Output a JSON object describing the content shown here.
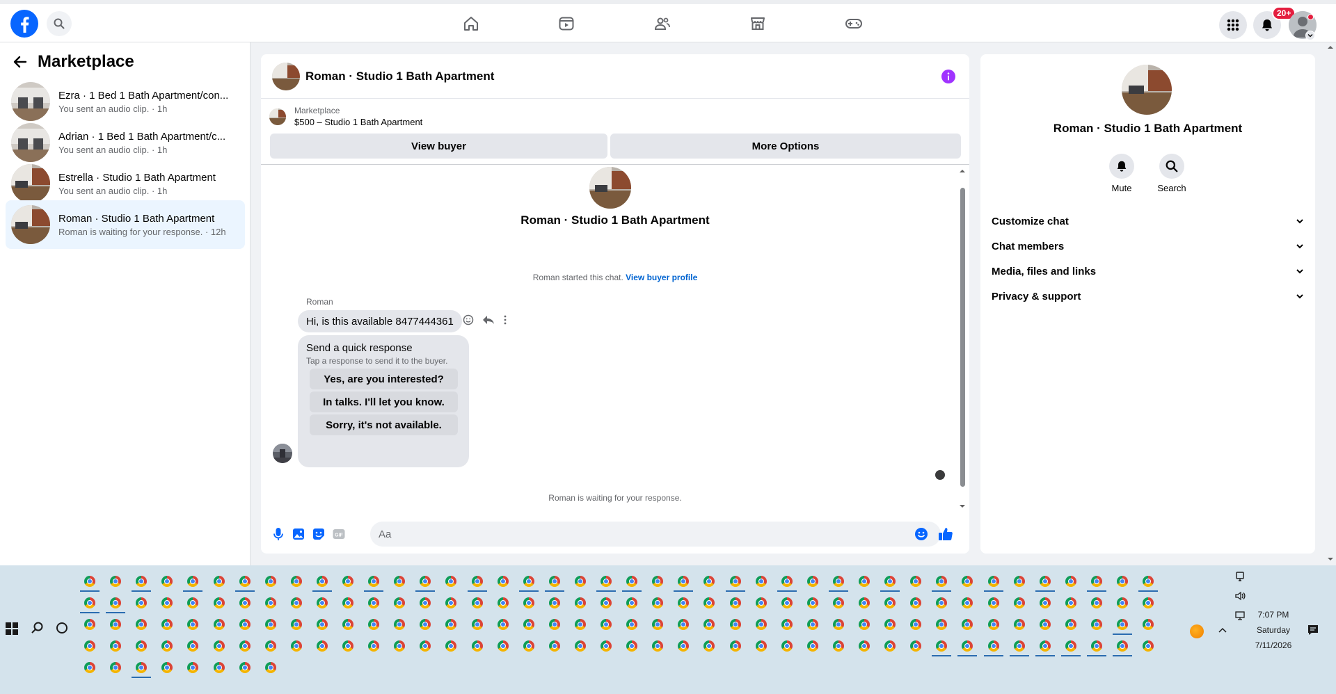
{
  "colors": {
    "brand": "#0866ff",
    "accent_blue": "#0064d1",
    "info_purple": "#a033ff",
    "badge_red": "#e41e3f"
  },
  "topbar": {
    "notification_count": "20+",
    "icons": [
      "facebook-logo",
      "search-icon",
      "home-icon",
      "video-icon",
      "friends-icon",
      "marketplace-icon",
      "gaming-icon",
      "menu-grid-icon",
      "bell-icon",
      "profile-avatar"
    ]
  },
  "sidebar": {
    "title": "Marketplace",
    "conversations": [
      {
        "title": "Ezra · 1 Bed 1 Bath Apartment/con...",
        "subtitle": "You sent an audio clip. · 1h",
        "active": false
      },
      {
        "title": "Adrian · 1 Bed 1 Bath Apartment/c...",
        "subtitle": "You sent an audio clip. · 1h",
        "active": false
      },
      {
        "title": "Estrella · Studio 1 Bath Apartment",
        "subtitle": "You sent an audio clip. · 1h",
        "active": false
      },
      {
        "title": "Roman · Studio 1 Bath Apartment",
        "subtitle": "Roman is waiting for your response. · 12h",
        "active": true
      }
    ]
  },
  "chat": {
    "header_title": "Roman · Studio 1 Bath Apartment",
    "marketplace_label": "Marketplace",
    "listing": "$500 – Studio 1 Bath Apartment",
    "view_buyer": "View buyer",
    "more_options": "More Options",
    "profile_name": "Roman · Studio 1 Bath Apartment",
    "started_text": "Roman started this chat.",
    "view_buyer_profile": "View buyer profile",
    "sender": "Roman",
    "message": "Hi, is this available 8477444361",
    "quick_title": "Send a quick response",
    "quick_sub": "Tap a response to send it to the buyer.",
    "quick_options": [
      "Yes, are you interested?",
      "In talks. I'll let you know.",
      "Sorry, it's not available."
    ],
    "waiting": "Roman is waiting for your response.",
    "input_placeholder": "Aa"
  },
  "details": {
    "name": "Roman · Studio 1 Bath Apartment",
    "mute": "Mute",
    "search": "Search",
    "sections": [
      "Customize chat",
      "Chat members",
      "Media, files and links",
      "Privacy & support"
    ]
  },
  "taskbar": {
    "time": "7:07 PM",
    "day": "Saturday",
    "date": "7/11/2026"
  }
}
